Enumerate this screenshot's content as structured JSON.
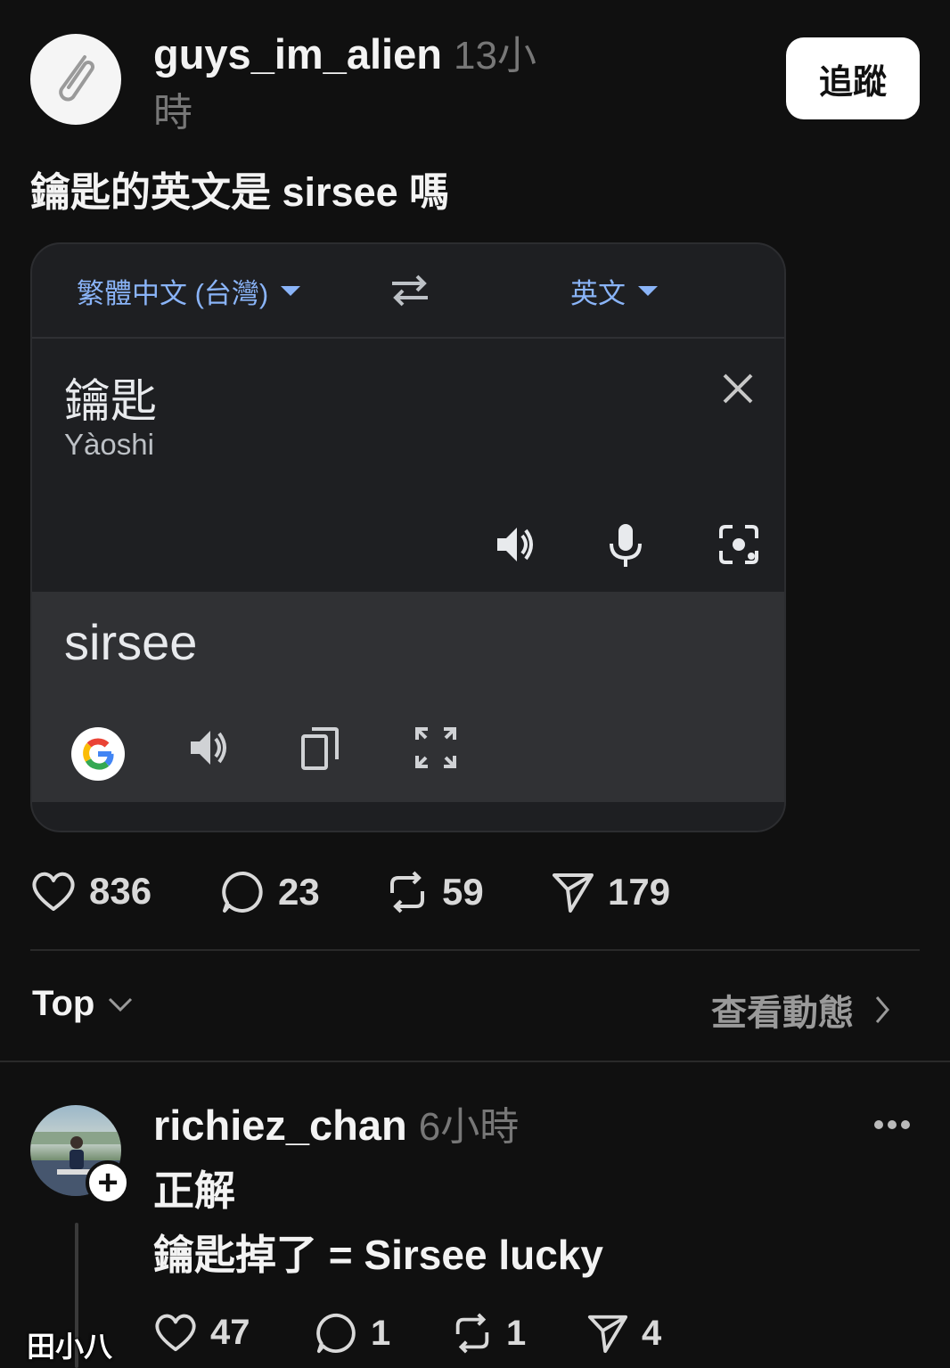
{
  "post": {
    "username": "guys_im_alien",
    "time_line1": "13小",
    "time_line2": "時",
    "follow_label": "追蹤",
    "text": "鑰匙的英文是 sirsee 嗎"
  },
  "translate_card": {
    "source_lang": "繁體中文 (台灣)",
    "target_lang": "英文",
    "source_text": "鑰匙",
    "romanization": "Yàoshi",
    "result_text": "sirsee"
  },
  "post_stats": {
    "likes": "836",
    "comments": "23",
    "reposts": "59",
    "shares": "179"
  },
  "sort_bar": {
    "sort_label": "Top",
    "activity_label": "查看動態"
  },
  "reply": {
    "username": "richiez_chan",
    "time": "6小時",
    "line1": "正解",
    "line2": "鑰匙掉了 = Sirsee lucky",
    "likes": "47",
    "comments": "1",
    "reposts": "1",
    "shares": "4"
  },
  "watermark": "田小八",
  "colors": {
    "background": "#101010",
    "card": "#1e1f22",
    "result_bg": "#303134",
    "link_blue": "#8ab4f8"
  }
}
